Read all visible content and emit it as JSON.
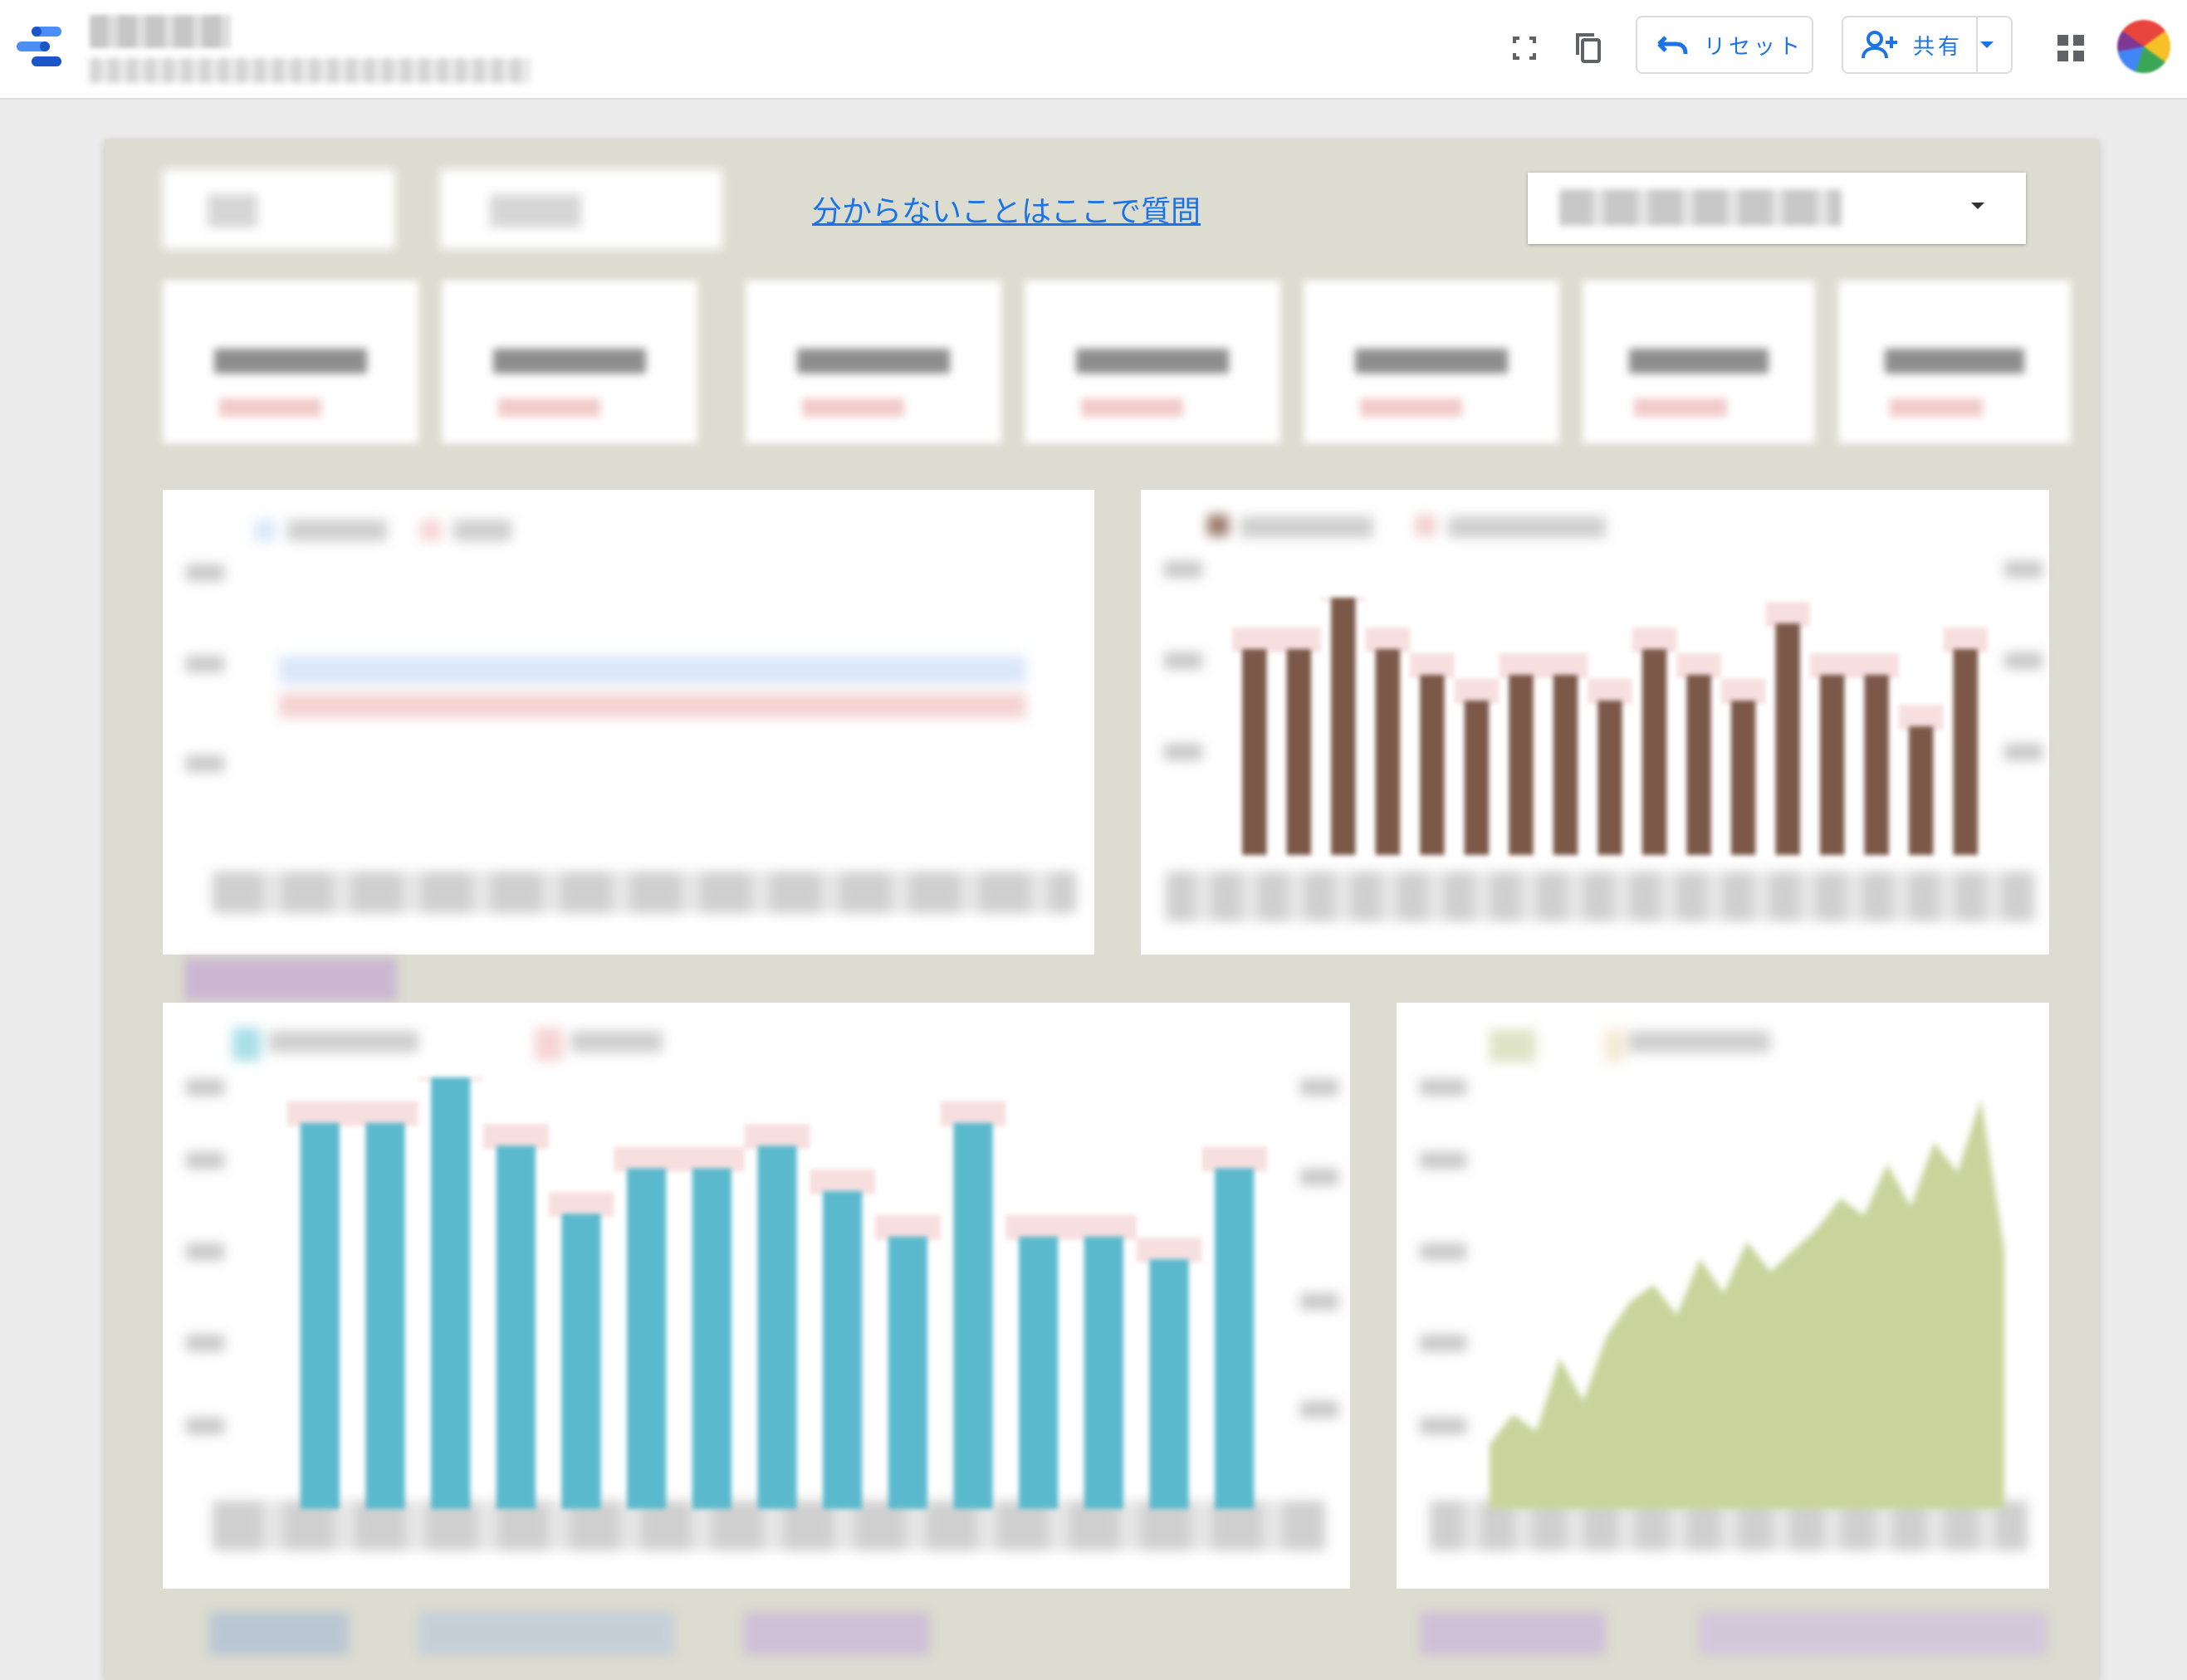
{
  "header": {
    "title": "",
    "subtitle": "",
    "reset_label": "リセット",
    "share_label": "共有",
    "icons": [
      "data-studio-logo",
      "fullscreen-icon",
      "copy-icon",
      "undo-icon",
      "add-person-icon",
      "apps-grid-icon"
    ]
  },
  "report": {
    "help_link": "分からないことはここで質問",
    "dropdown_value": ""
  },
  "charts": {
    "brown_bars": {
      "type": "bar",
      "values": [
        80,
        80,
        100,
        80,
        70,
        60,
        70,
        70,
        60,
        80,
        70,
        60,
        90,
        70,
        70,
        50,
        80
      ],
      "color": "#7b5848"
    },
    "teal_bars": {
      "type": "bar",
      "values": [
        85,
        85,
        95,
        80,
        65,
        75,
        75,
        80,
        70,
        60,
        85,
        60,
        60,
        55,
        75
      ],
      "color": "#5bb9cd"
    },
    "green_area": {
      "type": "area",
      "values": [
        15,
        22,
        18,
        35,
        25,
        40,
        48,
        52,
        45,
        58,
        50,
        62,
        55,
        60,
        65,
        72,
        68,
        80,
        70,
        85,
        78,
        95,
        60
      ],
      "color": "#c9d39b"
    }
  },
  "colors": {
    "canvas": "#dcdcd0",
    "accent": "#1a73e8",
    "pink": "#f1c9c9",
    "purple": "#cbb7d1",
    "blue_gray": "#bac7d3"
  }
}
